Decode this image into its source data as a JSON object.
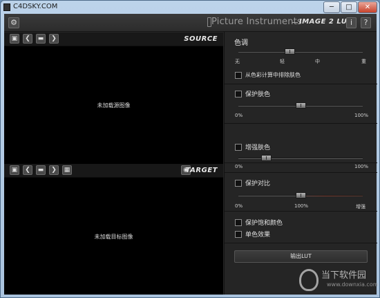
{
  "window": {
    "title": "C4DSKY.COM",
    "minimize_glyph": "─",
    "maximize_glyph": "□",
    "close_glyph": "✕"
  },
  "header": {
    "settings_icon": "gear-icon",
    "brand": "Picture Instruments",
    "app_name": "IMAGE 2 LUT",
    "info_label": "i",
    "help_label": "?"
  },
  "source": {
    "label": "SOURCE",
    "placeholder": "未加载源图像",
    "buttons": [
      {
        "name": "save-icon",
        "glyph": "▣"
      },
      {
        "name": "prev-icon",
        "glyph": "❮"
      },
      {
        "name": "folder-icon",
        "glyph": "▬"
      },
      {
        "name": "next-icon",
        "glyph": "❯"
      }
    ]
  },
  "target": {
    "label": "TARGET",
    "placeholder": "未加载目标图像",
    "eye_icon": "eye-icon",
    "buttons": [
      {
        "name": "save-icon",
        "glyph": "▣"
      },
      {
        "name": "prev-icon",
        "glyph": "❮"
      },
      {
        "name": "folder-icon",
        "glyph": "▬"
      },
      {
        "name": "next-icon",
        "glyph": "❯"
      },
      {
        "name": "grid-icon",
        "glyph": "▦"
      }
    ]
  },
  "panel": {
    "tone": {
      "title": "色调",
      "ticks": [
        "无",
        "轻",
        "中",
        "重"
      ],
      "level": 0.41,
      "exclude_skin_label": "从色彩计算中排除肤色"
    },
    "protect_skin": {
      "label": "保护肤色",
      "min": "0%",
      "max": "100%",
      "level": 0.5
    },
    "enhance_skin": {
      "label": "增强肤色",
      "min": "0%",
      "max": "100%",
      "level": 0.22
    },
    "protect_contrast": {
      "label": "保护对比",
      "min": "0%",
      "mid": "100%",
      "max": "增强",
      "level": 0.5
    },
    "protect_saturation_label": "保护饱和颜色",
    "monochrome_label": "单色效果",
    "export_label": "输出LUT"
  },
  "watermark": {
    "name": "当下软件园",
    "url": "www.downxia.com"
  }
}
